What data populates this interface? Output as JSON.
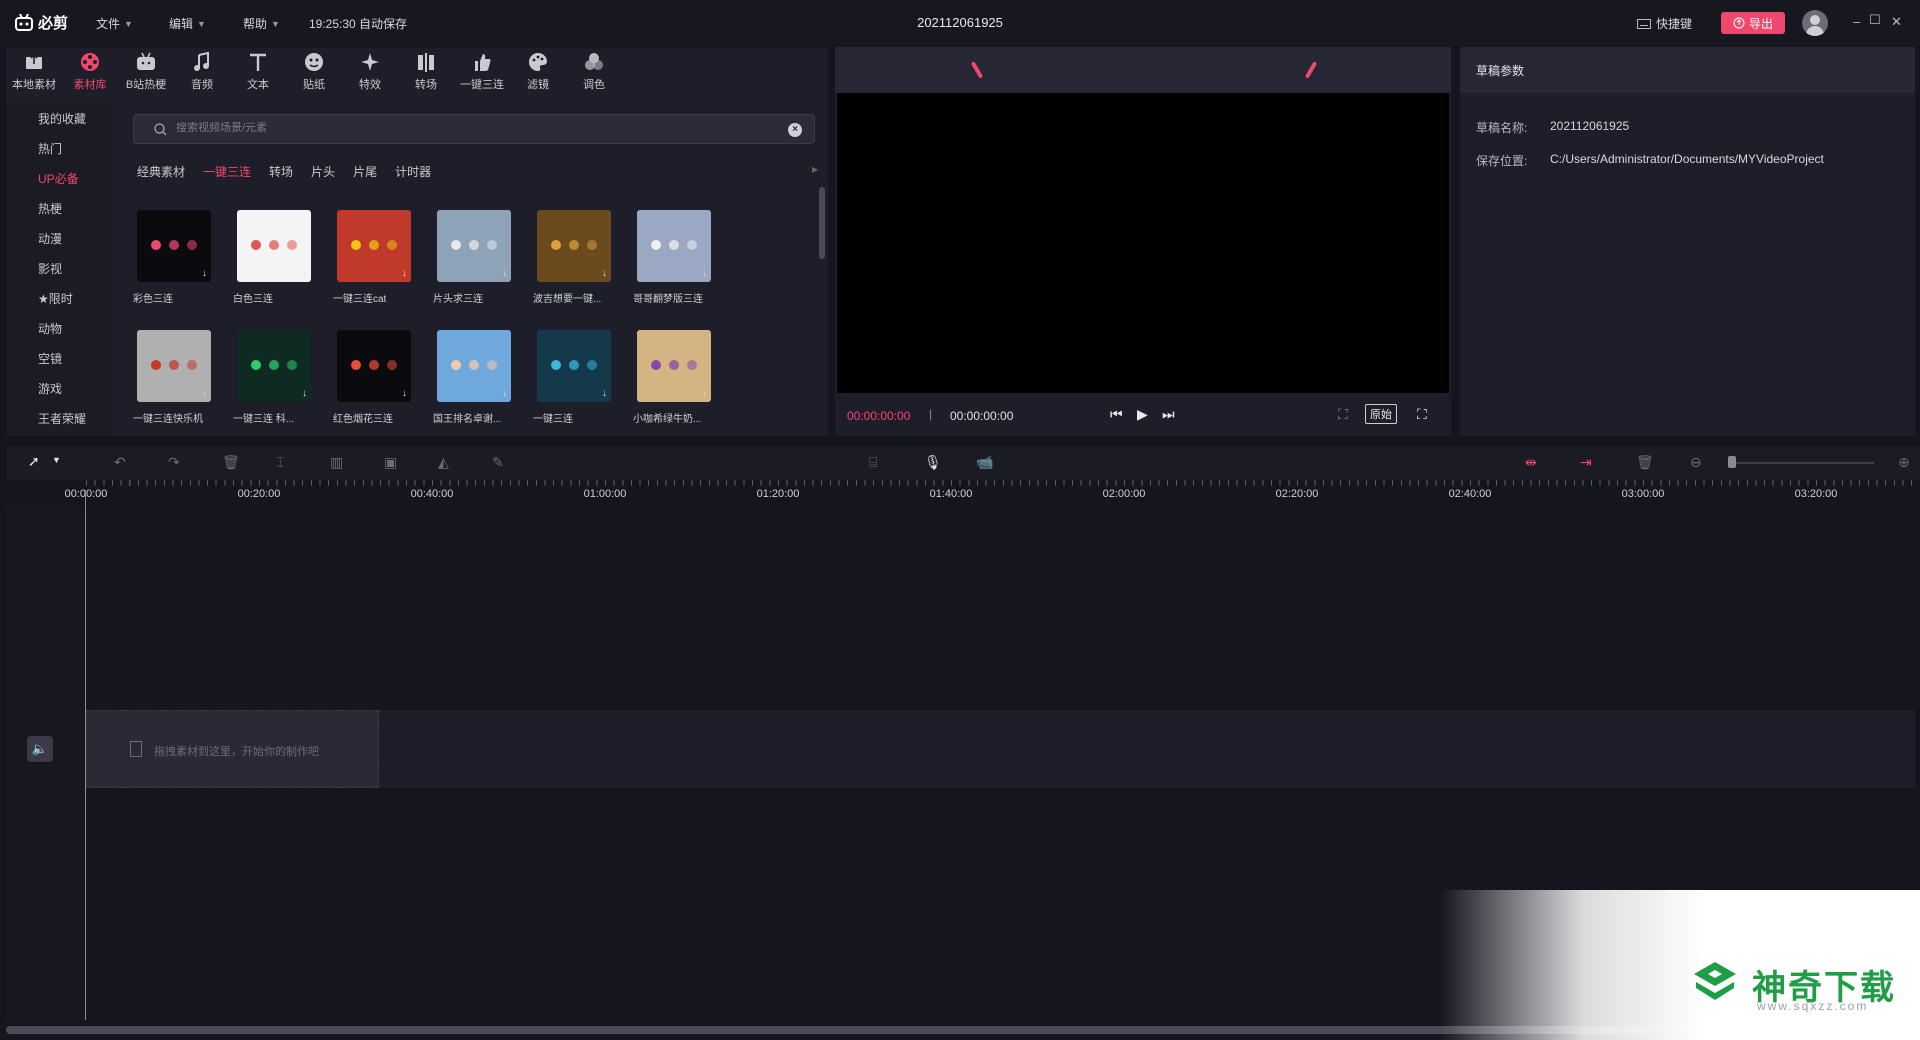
{
  "app": {
    "name": "必剪",
    "menus": [
      "文件",
      "编辑",
      "帮助"
    ],
    "autosave": "19:25:30 自动保存",
    "project_title": "202112061925",
    "shortcut_label": "快捷键",
    "export_label": "导出"
  },
  "toolbar": [
    {
      "label": "本地素材",
      "icon": "upload-folder-icon",
      "active": false
    },
    {
      "label": "素材库",
      "icon": "film-reel-icon",
      "active": true
    },
    {
      "label": "B站热梗",
      "icon": "tv-icon",
      "active": false
    },
    {
      "label": "音频",
      "icon": "music-note-icon",
      "active": false
    },
    {
      "label": "文本",
      "icon": "text-icon",
      "active": false
    },
    {
      "label": "贴纸",
      "icon": "sticker-icon",
      "active": false
    },
    {
      "label": "特效",
      "icon": "sparkle-icon",
      "active": false
    },
    {
      "label": "转场",
      "icon": "transition-icon",
      "active": false
    },
    {
      "label": "一键三连",
      "icon": "thumbs-up-icon",
      "active": false
    },
    {
      "label": "滤镜",
      "icon": "palette-icon",
      "active": false
    },
    {
      "label": "调色",
      "icon": "color-adjust-icon",
      "active": false
    }
  ],
  "categories": [
    {
      "label": "我的收藏",
      "active": false
    },
    {
      "label": "热门",
      "active": false
    },
    {
      "label": "UP必备",
      "active": true
    },
    {
      "label": "热梗",
      "active": false
    },
    {
      "label": "动漫",
      "active": false
    },
    {
      "label": "影视",
      "active": false
    },
    {
      "label": "★限时",
      "active": false
    },
    {
      "label": "动物",
      "active": false
    },
    {
      "label": "空镜",
      "active": false
    },
    {
      "label": "游戏",
      "active": false
    },
    {
      "label": "王者荣耀",
      "active": false
    }
  ],
  "search": {
    "placeholder": "搜索视频场景/元素"
  },
  "subtabs": [
    {
      "label": "经典素材",
      "active": false
    },
    {
      "label": "一键三连",
      "active": true
    },
    {
      "label": "转场",
      "active": false
    },
    {
      "label": "片头",
      "active": false
    },
    {
      "label": "片尾",
      "active": false
    },
    {
      "label": "计时器",
      "active": false
    }
  ],
  "materials": [
    {
      "label": "彩色三连",
      "bg": "#0b0b0f",
      "accent": "#f0476e"
    },
    {
      "label": "白色三连",
      "bg": "#f4f4f4",
      "accent": "#e05555"
    },
    {
      "label": "一键三连cat",
      "bg": "#c0392b",
      "accent": "#f1c40f"
    },
    {
      "label": "片头求三连",
      "bg": "#8fa3b8",
      "accent": "#e8e8ee"
    },
    {
      "label": "波吉想要一键...",
      "bg": "#6b4a1e",
      "accent": "#d8a040"
    },
    {
      "label": "哥哥翻梦版三连",
      "bg": "#9aa8c4",
      "accent": "#f0f0f0"
    },
    {
      "label": "一键三连快乐机",
      "bg": "#b0b0b0",
      "accent": "#c0392b"
    },
    {
      "label": "一键三连 科...",
      "bg": "#0f2a22",
      "accent": "#2ecc71"
    },
    {
      "label": "红色烟花三连",
      "bg": "#0b0b0f",
      "accent": "#e74c3c"
    },
    {
      "label": "国王排名卓谢...",
      "bg": "#6fa8dc",
      "accent": "#f5cba7"
    },
    {
      "label": "一键三连",
      "bg": "#13394a",
      "accent": "#3bb8d8"
    },
    {
      "label": "小咖希绿牛奶...",
      "bg": "#d4b483",
      "accent": "#8e44ad"
    }
  ],
  "player": {
    "current_time": "00:00:00:00",
    "total_time": "00:00:00:00",
    "ratio_label": "原始"
  },
  "props": {
    "title": "草稿参数",
    "name_label": "草稿名称:",
    "name_value": "202112061925",
    "path_label": "保存位置:",
    "path_value": "C:/Users/Administrator/Documents/MYVideoProject"
  },
  "timeline": {
    "ruler_labels": [
      "00:00:00",
      "00:20:00",
      "00:40:00",
      "01:00:00",
      "01:20:00",
      "01:40:00",
      "02:00:00",
      "02:20:00",
      "02:40:00",
      "03:00:00",
      "03:20:00"
    ],
    "drop_hint": "拖拽素材到这里，开始你的制作吧"
  },
  "watermark": {
    "text": "神奇下载",
    "url": "www.sqxzz.com"
  }
}
